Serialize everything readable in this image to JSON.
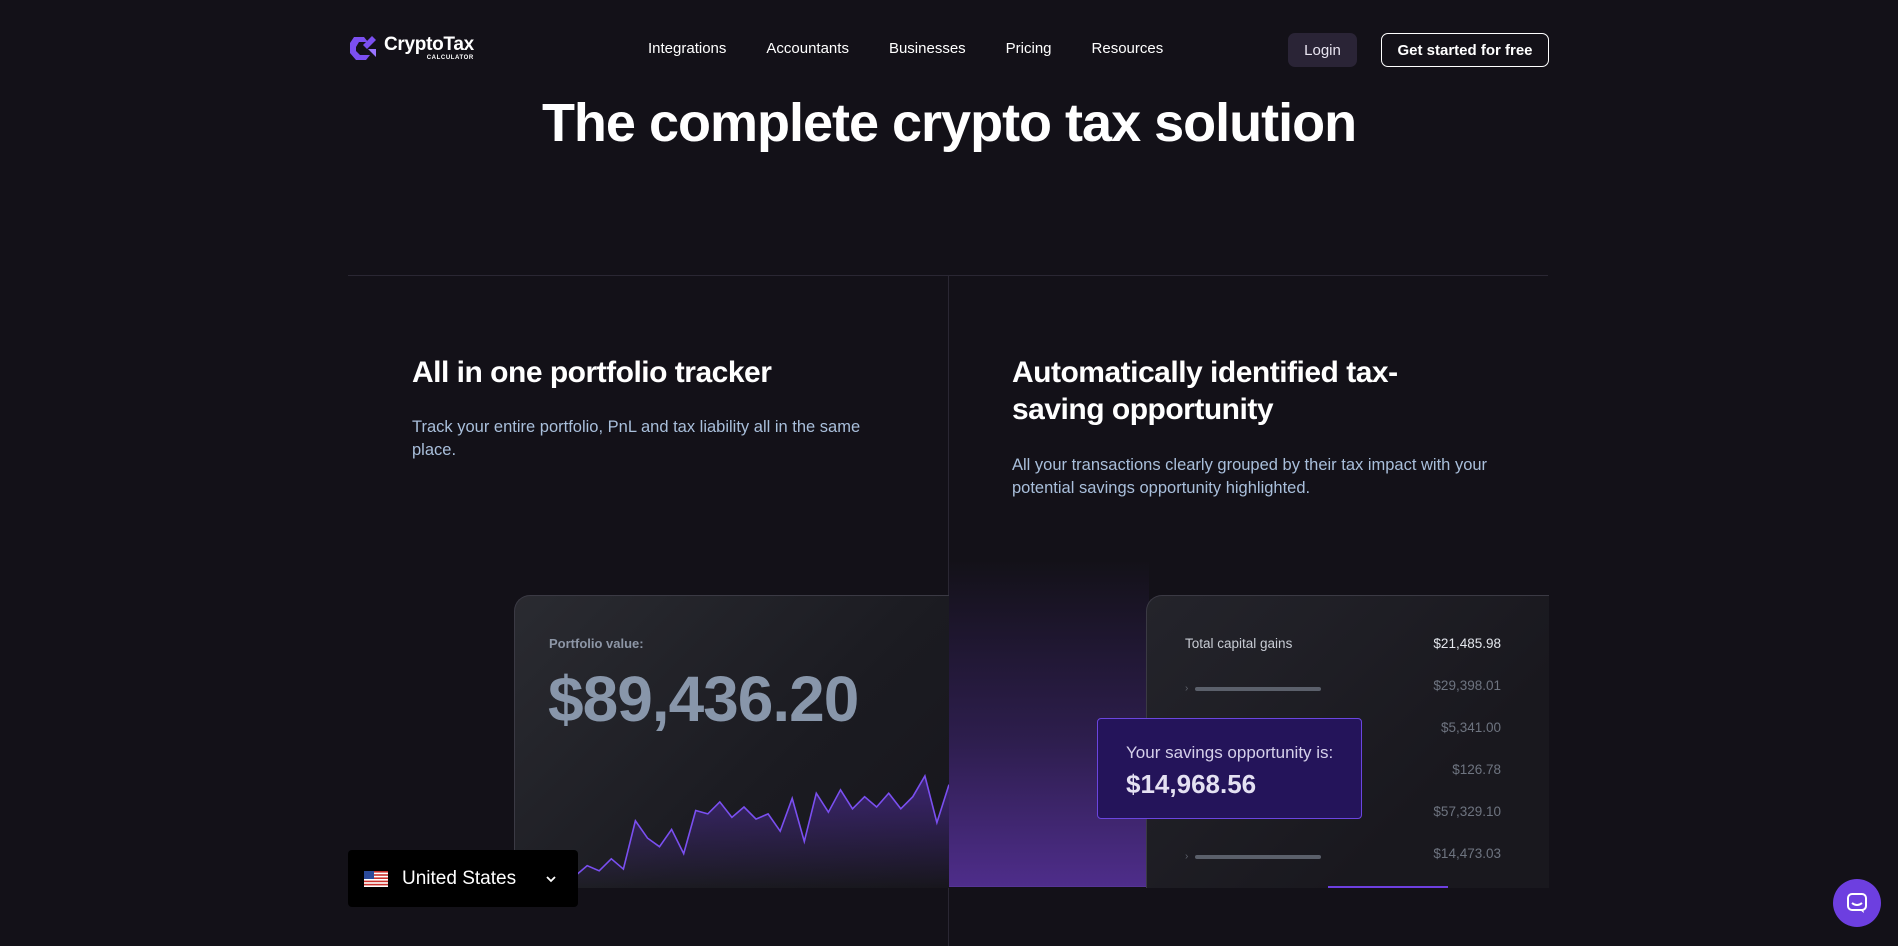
{
  "brand": {
    "name": "CryptoTax",
    "sub": "CALCULATOR",
    "accent": "#7b4ff0"
  },
  "nav": {
    "items": [
      "Integrations",
      "Accountants",
      "Businesses",
      "Pricing",
      "Resources"
    ],
    "login": "Login",
    "cta": "Get started for free"
  },
  "hero": {
    "title": "The complete crypto tax solution"
  },
  "features": [
    {
      "title": "All in one portfolio tracker",
      "desc": "Track your entire portfolio, PnL and tax liability all in the same place."
    },
    {
      "title": "Automatically identified tax-saving opportunity",
      "desc": "All your transactions clearly grouped by their tax impact with your potential savings opportunity highlighted."
    }
  ],
  "portfolio": {
    "label": "Portfolio value:",
    "value": "$89,436.20",
    "sparkline_values": [
      3,
      9,
      2,
      8,
      5,
      12,
      6,
      34,
      24,
      19,
      29,
      15,
      40,
      38,
      45,
      36,
      42,
      35,
      38,
      28,
      47,
      22,
      50,
      39,
      52,
      41,
      48,
      42,
      50,
      41,
      48,
      60,
      33,
      55
    ]
  },
  "gains": {
    "title_label": "Total capital gains",
    "title_value": "$21,485.98",
    "rows": [
      "$29,398.01",
      "$5,341.00",
      "$126.78",
      "$57,329.10",
      "$14,473.03"
    ]
  },
  "savings": {
    "label": "Your savings opportunity is:",
    "value": "$14,968.56"
  },
  "country": {
    "name": "United States",
    "flag_icon": "us-flag-icon"
  },
  "chat": {
    "icon": "chat-icon"
  }
}
